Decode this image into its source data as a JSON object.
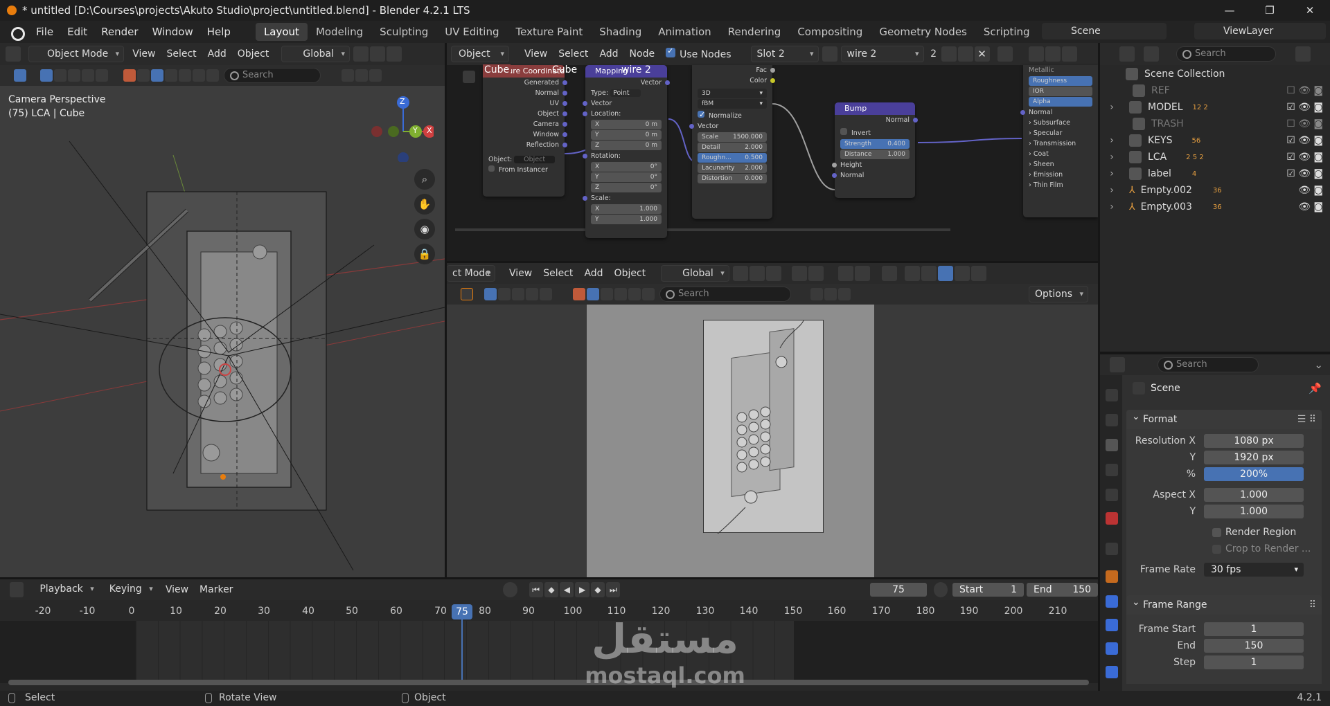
{
  "window": {
    "title": "* untitled [D:\\Courses\\projects\\Akuto Studio\\project\\untitled.blend] - Blender 4.2.1 LTS"
  },
  "menu": [
    "File",
    "Edit",
    "Render",
    "Window",
    "Help"
  ],
  "workspaces": [
    "Layout",
    "Modeling",
    "Sculpting",
    "UV Editing",
    "Texture Paint",
    "Shading",
    "Animation",
    "Rendering",
    "Compositing",
    "Geometry Nodes",
    "Scripting"
  ],
  "scene_name": "Scene",
  "view_layer": "ViewLayer",
  "viewport": {
    "mode": "Object Mode",
    "menus": [
      "View",
      "Select",
      "Add",
      "Object"
    ],
    "orientation": "Global",
    "search_placeholder": "Search",
    "overlay_line1": "Camera Perspective",
    "overlay_line2": "(75) LCA | Cube",
    "gizmo_z": "Z",
    "gizmo_x": "X",
    "gizmo_y": "Y"
  },
  "node_editor": {
    "type": "Object",
    "menus": [
      "View",
      "Select",
      "Add",
      "Node"
    ],
    "use_nodes": "Use Nodes",
    "slot": "Slot 2",
    "material": "wire 2",
    "users": "2",
    "tex_coord": {
      "title": "Texture Coordinate",
      "obj_label": "Cube",
      "outputs": [
        "Generated",
        "Normal",
        "UV",
        "Object",
        "Camera",
        "Window",
        "Reflection"
      ],
      "object_label": "Object:",
      "object_placeholder": "Object",
      "from_instancer": "From Instancer"
    },
    "mapping": {
      "title": "Mapping",
      "mat_label": "wire 2",
      "out": "Vector",
      "type_label": "Type:",
      "type_value": "Point",
      "vector": "Vector",
      "location": "Location:",
      "rotation": "Rotation:",
      "scale": "Scale:",
      "loc": [
        [
          "X",
          "0 m"
        ],
        [
          "Y",
          "0 m"
        ],
        [
          "Z",
          "0 m"
        ]
      ],
      "rot": [
        [
          "X",
          "0°"
        ],
        [
          "Y",
          "0°"
        ],
        [
          "Z",
          "0°"
        ]
      ],
      "scl": [
        [
          "X",
          "1.000"
        ],
        [
          "Y",
          "1.000"
        ]
      ]
    },
    "noise": {
      "fac": "Fac",
      "color": "Color",
      "dim": "3D",
      "basis": "fBM",
      "normalize": "Normalize",
      "vector": "Vector",
      "fields": [
        [
          "Scale",
          "1500.000"
        ],
        [
          "Detail",
          "2.000"
        ],
        [
          "Roughn...",
          "0.500"
        ],
        [
          "Lacunarity",
          "2.000"
        ],
        [
          "Distortion",
          "0.000"
        ]
      ]
    },
    "bump": {
      "title": "Bump",
      "normal_out": "Normal",
      "invert": "Invert",
      "strength_label": "Strength",
      "strength": "0.400",
      "distance_label": "Distance",
      "distance": "1.000",
      "height": "Height",
      "normal_in": "Normal"
    },
    "bsdf": {
      "rows": [
        "Metallic",
        "Roughness",
        "IOR",
        "Alpha",
        "Normal"
      ],
      "subpanels": [
        "Subsurface",
        "Specular",
        "Transmission",
        "Coat",
        "Sheen",
        "Emission",
        "Thin Film"
      ]
    }
  },
  "camview": {
    "mode": "ct Mode",
    "menus": [
      "View",
      "Select",
      "Add",
      "Object"
    ],
    "orientation": "Global",
    "search_placeholder": "Search",
    "options": "Options"
  },
  "outliner": {
    "search_placeholder": "Search",
    "root": "Scene Collection",
    "items": [
      {
        "name": "REF",
        "badge": ""
      },
      {
        "name": "MODEL",
        "badge": "12  2"
      },
      {
        "name": "TRASH",
        "badge": ""
      },
      {
        "name": "KEYS",
        "badge": "56"
      },
      {
        "name": "LCA",
        "badge": "2  5  2"
      },
      {
        "name": "label",
        "badge": "4"
      },
      {
        "name": "Empty.002",
        "badge": "36"
      },
      {
        "name": "Empty.003",
        "badge": "36"
      }
    ]
  },
  "properties": {
    "search_placeholder": "Search",
    "context": "Scene",
    "format": {
      "title": "Format",
      "res_x_label": "Resolution X",
      "res_x": "1080 px",
      "res_y_label": "Y",
      "res_y": "1920 px",
      "pct_label": "%",
      "pct": "200%",
      "asp_x_label": "Aspect X",
      "asp_x": "1.000",
      "asp_y_label": "Y",
      "asp_y": "1.000",
      "render_region": "Render Region",
      "crop": "Crop to Render ...",
      "fps_label": "Frame Rate",
      "fps": "30 fps"
    },
    "frame_range": {
      "title": "Frame Range",
      "start_label": "Frame Start",
      "start": "1",
      "end_label": "End",
      "end": "150",
      "step_label": "Step",
      "step": "1"
    }
  },
  "timeline": {
    "menus": [
      "Playback",
      "Keying",
      "View",
      "Marker"
    ],
    "current_frame": "75",
    "start_label": "Start",
    "start": "1",
    "end_label": "End",
    "end": "150",
    "ticks": [
      "-20",
      "-10",
      "0",
      "10",
      "20",
      "30",
      "40",
      "50",
      "60",
      "70",
      "80",
      "90",
      "100",
      "110",
      "120",
      "130",
      "140",
      "150",
      "160",
      "170",
      "180",
      "190",
      "200",
      "210"
    ],
    "playhead": "75"
  },
  "statusbar": {
    "select": "Select",
    "rotate": "Rotate View",
    "object": "Object",
    "version": "4.2.1"
  },
  "watermark": {
    "arabic": "مستقل",
    "latin": "mostaql.com"
  }
}
